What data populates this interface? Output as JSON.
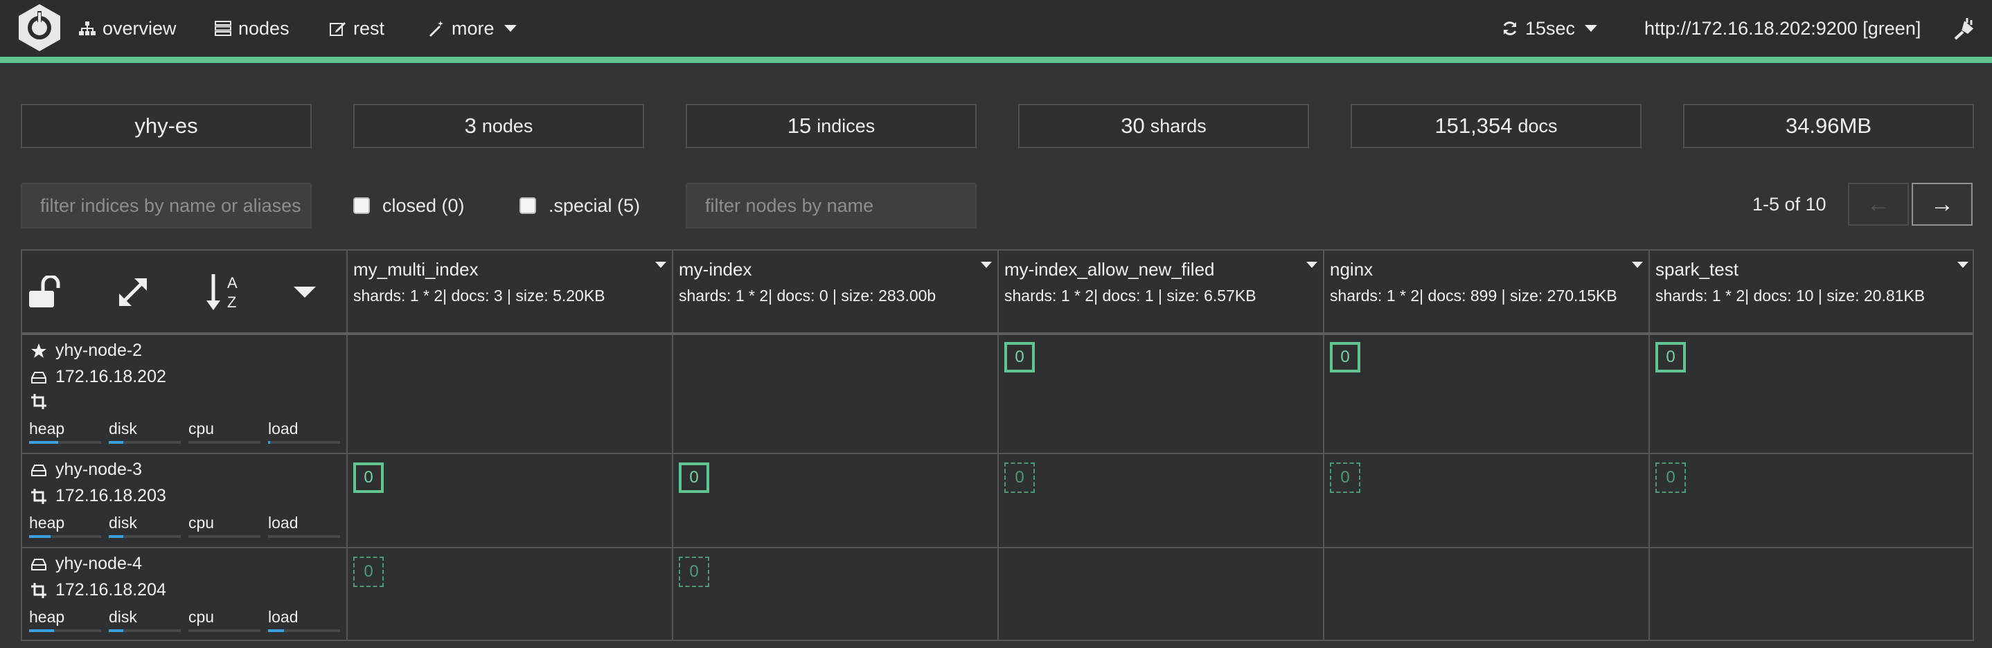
{
  "nav": {
    "logo": "elastichq-logo",
    "items": [
      {
        "label": "overview",
        "icon": "sitemap-icon"
      },
      {
        "label": "nodes",
        "icon": "server-icon"
      },
      {
        "label": "rest",
        "icon": "edit-icon"
      },
      {
        "label": "more",
        "icon": "magic-wand-icon"
      }
    ],
    "refresh": {
      "label": "15sec",
      "icon": "refresh-icon"
    },
    "connection": "http://172.16.18.202:9200 [green]",
    "plug_icon": "plug-icon",
    "accent_color": "#62c490"
  },
  "stats": {
    "cluster_name": "yhy-es",
    "nodes": {
      "value": "3",
      "unit": "nodes"
    },
    "indices": {
      "value": "15",
      "unit": "indices"
    },
    "shards": {
      "value": "30",
      "unit": "shards"
    },
    "docs": {
      "value": "151,354",
      "unit": "docs"
    },
    "size": "34.96MB"
  },
  "filters": {
    "indices_placeholder": "filter indices by name or aliases",
    "closed_label": "closed (0)",
    "special_label": ".special (5)",
    "nodes_placeholder": "filter nodes by name",
    "pagination": "1-5 of 10",
    "prev": "←",
    "next": "→"
  },
  "grid": {
    "corner_icons": [
      "unlock-icon",
      "expand-icon",
      "sort-alpha-icon",
      "caret-down-icon"
    ],
    "indices": [
      {
        "name": "my_multi_index",
        "meta": "shards: 1 * 2| docs: 3 | size: 5.20KB"
      },
      {
        "name": "my-index",
        "meta": "shards: 1 * 2| docs: 0 | size: 283.00b"
      },
      {
        "name": "my-index_allow_new_filed",
        "meta": "shards: 1 * 2| docs: 1 | size: 6.57KB"
      },
      {
        "name": "nginx",
        "meta": "shards: 1 * 2| docs: 899 | size: 270.15KB"
      },
      {
        "name": "spark_test",
        "meta": "shards: 1 * 2| docs: 10 | size: 20.81KB"
      }
    ],
    "nodes": [
      {
        "name": "yhy-node-2",
        "ip": "172.16.18.202",
        "roles": [
          "master-star-icon",
          "data-hdd-icon",
          "ingest-crop-icon"
        ],
        "metrics": [
          {
            "label": "heap",
            "fill": 0.4
          },
          {
            "label": "disk",
            "fill": 0.2
          },
          {
            "label": "cpu",
            "fill": 0.0
          },
          {
            "label": "load",
            "fill": 0.03
          }
        ],
        "shards": [
          null,
          null,
          {
            "n": "0",
            "type": "primary"
          },
          {
            "n": "0",
            "type": "primary"
          },
          {
            "n": "0",
            "type": "primary"
          }
        ]
      },
      {
        "name": "yhy-node-3",
        "ip": "172.16.18.203",
        "roles": [
          "data-hdd-icon",
          "ingest-crop-icon"
        ],
        "metrics": [
          {
            "label": "heap",
            "fill": 0.3
          },
          {
            "label": "disk",
            "fill": 0.2
          },
          {
            "label": "cpu",
            "fill": 0.0
          },
          {
            "label": "load",
            "fill": 0.0
          }
        ],
        "shards": [
          {
            "n": "0",
            "type": "primary"
          },
          {
            "n": "0",
            "type": "primary"
          },
          {
            "n": "0",
            "type": "replica"
          },
          {
            "n": "0",
            "type": "replica"
          },
          {
            "n": "0",
            "type": "replica"
          }
        ]
      },
      {
        "name": "yhy-node-4",
        "ip": "172.16.18.204",
        "roles": [
          "data-hdd-icon",
          "ingest-crop-icon"
        ],
        "metrics": [
          {
            "label": "heap",
            "fill": 0.35
          },
          {
            "label": "disk",
            "fill": 0.2
          },
          {
            "label": "cpu",
            "fill": 0.0
          },
          {
            "label": "load",
            "fill": 0.22
          }
        ],
        "shards": [
          {
            "n": "0",
            "type": "replica"
          },
          {
            "n": "0",
            "type": "replica"
          },
          null,
          null,
          null
        ]
      }
    ]
  }
}
